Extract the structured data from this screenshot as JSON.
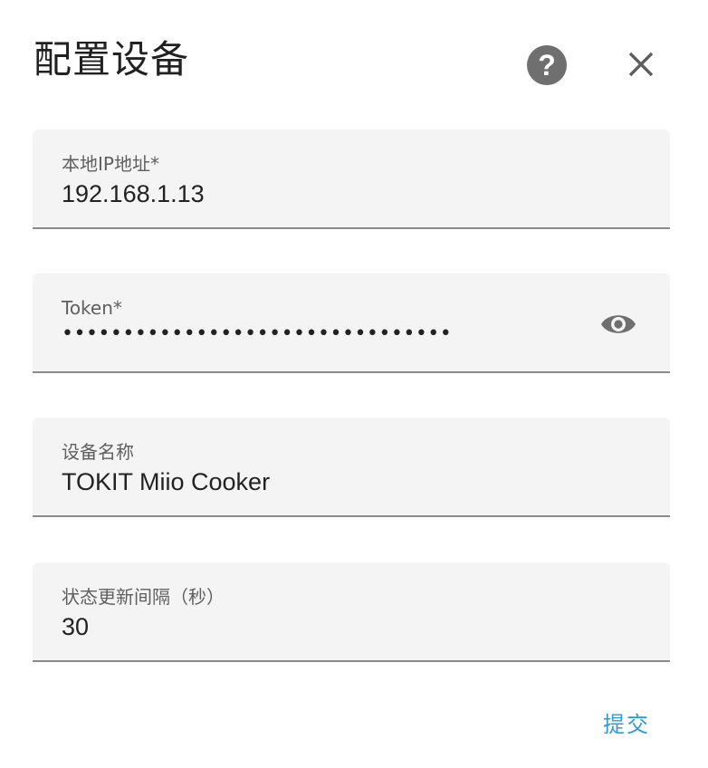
{
  "dialog": {
    "title": "配置设备",
    "help_label": "?",
    "close_icon": "close-icon",
    "help_icon": "help-circle-icon"
  },
  "fields": {
    "ip": {
      "label": "本地IP地址*",
      "value": "192.168.1.13"
    },
    "token": {
      "label": "Token*",
      "value": "••••••••••••••••••••••••••••••••",
      "toggle_icon": "eye-icon"
    },
    "name": {
      "label": "设备名称",
      "value": "TOKIT Miio Cooker"
    },
    "interval": {
      "label": "状态更新间隔（秒）",
      "value": "30"
    }
  },
  "actions": {
    "submit_label": "提交"
  },
  "colors": {
    "accent": "#2d9bd8",
    "field_bg": "#f4f4f4",
    "underline": "#8a8a8a",
    "icon": "#6f6f6f"
  }
}
